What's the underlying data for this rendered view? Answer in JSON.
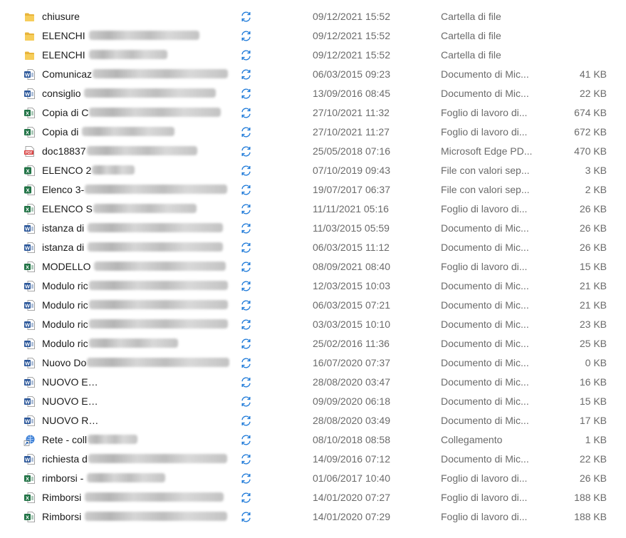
{
  "colors": {
    "folder": "#e8b43a",
    "word": "#2b579a",
    "excel": "#217346",
    "pdf": "#d83b3b",
    "sync": "#1e7ad9",
    "link": "#3c7fd6"
  },
  "files": [
    {
      "name": "chiusure",
      "blur": 0,
      "date": "09/12/2021 15:52",
      "type": "Cartella di file",
      "size": "",
      "icon": "folder-icon"
    },
    {
      "name": "ELENCHI ",
      "blur": 155,
      "date": "09/12/2021 15:52",
      "type": "Cartella di file",
      "size": "",
      "icon": "folder-icon"
    },
    {
      "name": "ELENCHI ",
      "blur": 110,
      "date": "09/12/2021 15:52",
      "type": "Cartella di file",
      "size": "",
      "icon": "folder-icon"
    },
    {
      "name": "Comunicaz",
      "blur": 190,
      "date": "06/03/2015 09:23",
      "type": "Documento di Mic...",
      "size": "41 KB",
      "icon": "word-icon"
    },
    {
      "name": "consiglio ",
      "blur": 185,
      "date": "13/09/2016 08:45",
      "type": "Documento di Mic...",
      "size": "22 KB",
      "icon": "word-icon"
    },
    {
      "name": "Copia di C",
      "blur": 185,
      "date": "27/10/2021 11:32",
      "type": "Foglio di lavoro di...",
      "size": "674 KB",
      "icon": "excel-icon"
    },
    {
      "name": "Copia di ",
      "blur": 130,
      "date": "27/10/2021 11:27",
      "type": "Foglio di lavoro di...",
      "size": "672 KB",
      "icon": "excel-icon"
    },
    {
      "name": "doc18837",
      "blur": 155,
      "date": "25/05/2018 07:16",
      "type": "Microsoft Edge PD...",
      "size": "470 KB",
      "icon": "pdf-icon"
    },
    {
      "name": "ELENCO 2",
      "blur": 60,
      "date": "07/10/2019 09:43",
      "type": "File con valori sep...",
      "size": "3 KB",
      "icon": "csv-icon"
    },
    {
      "name": "Elenco 3-",
      "blur": 200,
      "date": "19/07/2017 06:37",
      "type": "File con valori sep...",
      "size": "2 KB",
      "icon": "csv-icon"
    },
    {
      "name": "ELENCO S",
      "blur": 145,
      "date": "11/11/2021 05:16",
      "type": "Foglio di lavoro di...",
      "size": "26 KB",
      "icon": "excel-icon"
    },
    {
      "name": "istanza di ",
      "blur": 190,
      "date": "11/03/2015 05:59",
      "type": "Documento di Mic...",
      "size": "26 KB",
      "icon": "word-icon"
    },
    {
      "name": "istanza di ",
      "blur": 190,
      "date": "06/03/2015 11:12",
      "type": "Documento di Mic...",
      "size": "26 KB",
      "icon": "word-icon"
    },
    {
      "name": "MODELLO ",
      "blur": 185,
      "date": "08/09/2021 08:40",
      "type": "Foglio di lavoro di...",
      "size": "15 KB",
      "icon": "excel-icon"
    },
    {
      "name": "Modulo ric",
      "blur": 195,
      "date": "12/03/2015 10:03",
      "type": "Documento di Mic...",
      "size": "21 KB",
      "icon": "word-icon"
    },
    {
      "name": "Modulo ric",
      "blur": 195,
      "date": "06/03/2015 07:21",
      "type": "Documento di Mic...",
      "size": "21 KB",
      "icon": "word-icon"
    },
    {
      "name": "Modulo ric",
      "blur": 195,
      "date": "03/03/2015 10:10",
      "type": "Documento di Mic...",
      "size": "23 KB",
      "icon": "word-icon"
    },
    {
      "name": "Modulo ric",
      "blur": 125,
      "date": "25/02/2016 11:36",
      "type": "Documento di Mic...",
      "size": "25 KB",
      "icon": "word-icon"
    },
    {
      "name": "Nuovo Do",
      "blur": 200,
      "date": "16/07/2020 07:37",
      "type": "Documento di Mic...",
      "size": "0 KB",
      "icon": "word-icon"
    },
    {
      "name": "NUOVO E",
      "blur": 200,
      "date": "28/08/2020 03:47",
      "type": "Documento di Mic...",
      "size": "16 KB",
      "icon": "word-icon"
    },
    {
      "name": "NUOVO E",
      "blur": 200,
      "date": "09/09/2020 06:18",
      "type": "Documento di Mic...",
      "size": "15 KB",
      "icon": "word-icon"
    },
    {
      "name": "NUOVO R",
      "blur": 200,
      "date": "28/08/2020 03:49",
      "type": "Documento di Mic...",
      "size": "17 KB",
      "icon": "word-icon"
    },
    {
      "name": "Rete - coll",
      "blur": 70,
      "date": "08/10/2018 08:58",
      "type": "Collegamento",
      "size": "1 KB",
      "icon": "shortcut-icon"
    },
    {
      "name": "richiesta d",
      "blur": 195,
      "date": "14/09/2016 07:12",
      "type": "Documento di Mic...",
      "size": "22 KB",
      "icon": "word-icon"
    },
    {
      "name": "rimborsi - ",
      "blur": 110,
      "date": "01/06/2017 10:40",
      "type": "Foglio di lavoro di...",
      "size": "26 KB",
      "icon": "excel-icon"
    },
    {
      "name": "Rimborsi ",
      "blur": 195,
      "date": "14/01/2020 07:27",
      "type": "Foglio di lavoro di...",
      "size": "188 KB",
      "icon": "excel-icon"
    },
    {
      "name": "Rimborsi ",
      "blur": 200,
      "date": "14/01/2020 07:29",
      "type": "Foglio di lavoro di...",
      "size": "188 KB",
      "icon": "excel-icon"
    }
  ]
}
